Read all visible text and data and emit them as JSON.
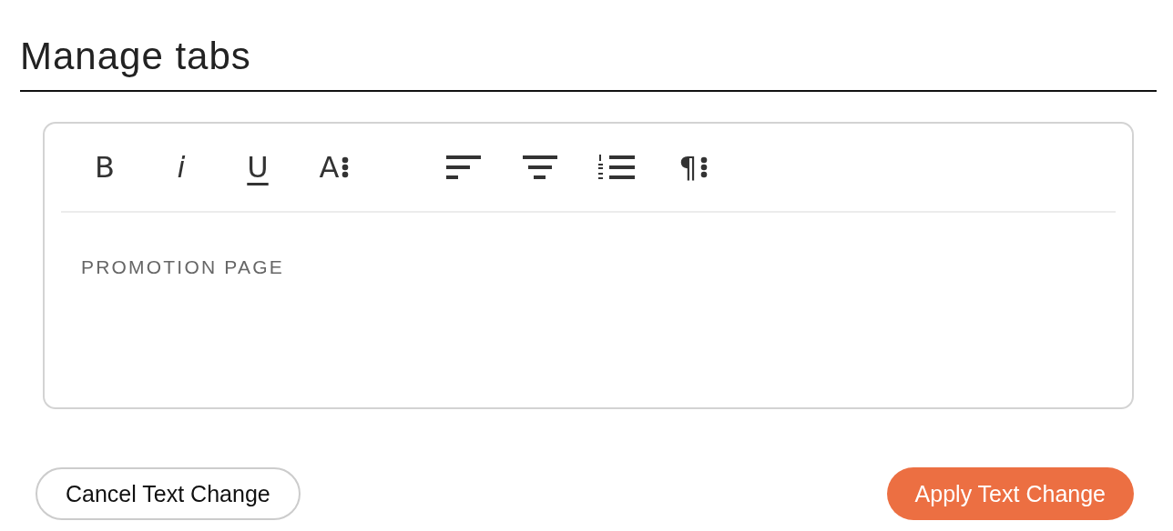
{
  "title": "Manage tabs",
  "toolbar": [
    {
      "kind": "bold",
      "label": "B"
    },
    {
      "kind": "italic",
      "label": "i"
    },
    {
      "kind": "underline",
      "label": "U"
    },
    {
      "kind": "font-size",
      "label": "A"
    },
    {
      "kind": "align-left"
    },
    {
      "kind": "align-center"
    },
    {
      "kind": "numbered-list"
    },
    {
      "kind": "paragraph",
      "label": "¶"
    }
  ],
  "editor": {
    "value": "PROMOTION PAGE"
  },
  "buttons": [
    {
      "kind": "secondary",
      "label": "Cancel Text Change"
    },
    {
      "kind": "primary",
      "label": "Apply Text Change"
    }
  ]
}
